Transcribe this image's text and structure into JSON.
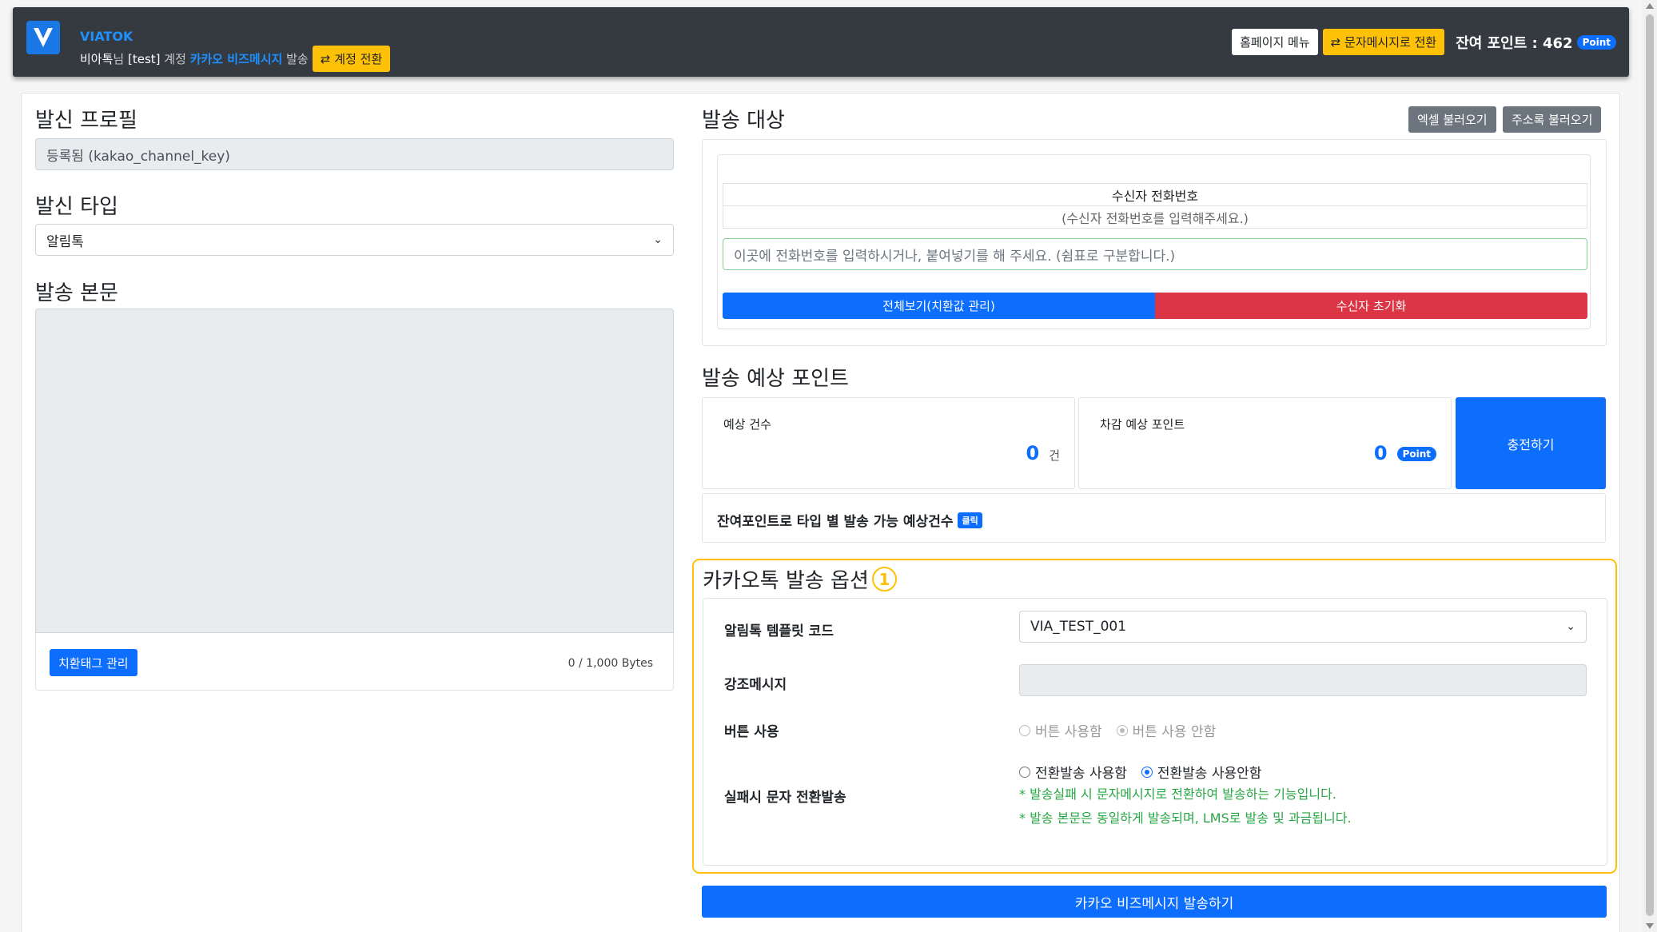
{
  "header": {
    "brand": "VIATOK",
    "user_name": "비아톡",
    "user_suffix": "님",
    "account_id": "[test]",
    "account_label": "계정",
    "service": "카카오 비즈메시지",
    "send_label": "발송",
    "switch_account": "계정 전환",
    "home_menu": "홈페이지 메뉴",
    "switch_sms": "문자메시지로 전환",
    "points_label": "잔여 포인트 : 462",
    "points_badge": "Point"
  },
  "left": {
    "profile_title": "발신 프로필",
    "profile_value": "등록됨 (kakao_channel_key)",
    "type_title": "발신 타입",
    "type_value": "알림톡",
    "body_title": "발송 본문",
    "tag_button": "치환태그 관리",
    "bytes": "0 / 1,000 Bytes"
  },
  "target": {
    "title": "발송 대상",
    "excel_button": "엑셀 불러오기",
    "address_button": "주소록 불러오기",
    "table_header": "수신자 전화번호",
    "table_empty": "(수신자 전화번호를 입력해주세요.)",
    "input_placeholder": "이곳에 전화번호를 입력하시거나, 붙여넣기를 해 주세요. (쉼표로 구분합니다.)",
    "view_all_button": "전체보기(치환값 관리)",
    "reset_button": "수신자 초기화"
  },
  "estimate": {
    "title": "발송 예상 포인트",
    "count_label": "예상 건수",
    "count_value": "0",
    "count_unit": "건",
    "deduct_label": "차감 예상 포인트",
    "deduct_value": "0",
    "deduct_unit": "Point",
    "charge_button": "충전하기",
    "remain_text": "잔여포인트로 타입 별 발송 가능 예상건수",
    "click_badge": "클릭"
  },
  "options": {
    "title": "카카오톡 발송 옵션",
    "step": "1",
    "template_label": "알림톡 템플릿 코드",
    "template_value": "VIA_TEST_001",
    "emphasis_label": "강조메시지",
    "button_label": "버튼 사용",
    "button_use": "버튼 사용함",
    "button_not_use": "버튼 사용 안함",
    "fallback_label": "실패시 문자 전환발송",
    "fallback_use": "전환발송 사용함",
    "fallback_not_use": "전환발송 사용안함",
    "note1": "* 발송실패 시 문자메시지로 전환하여 발송하는 기능입니다.",
    "note2": "* 발송 본문은 동일하게 발송되며, LMS로 발송 및 과금됩니다."
  },
  "send_button": "카카오 비즈메시지 발송하기",
  "colors": {
    "primary": "#0d6efd",
    "warning": "#ffc107",
    "danger": "#dc3545",
    "success": "#28a745",
    "header_bg": "#343a40"
  }
}
